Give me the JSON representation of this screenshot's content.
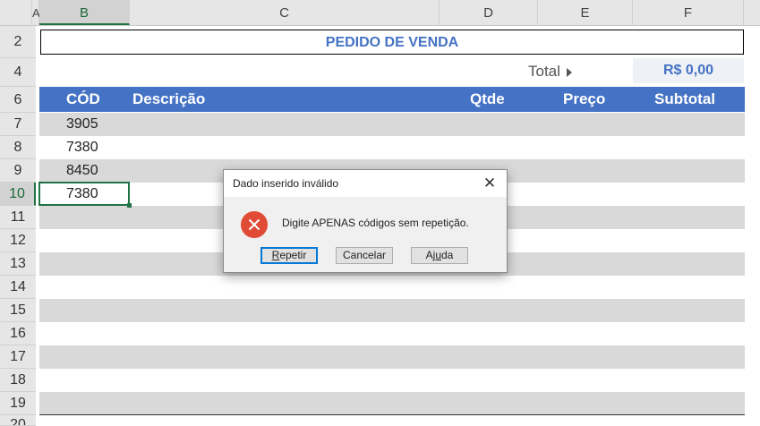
{
  "columns": [
    {
      "label": "A",
      "selected": false
    },
    {
      "label": "B",
      "selected": true
    },
    {
      "label": "C",
      "selected": false
    },
    {
      "label": "D",
      "selected": false
    },
    {
      "label": "E",
      "selected": false
    },
    {
      "label": "F",
      "selected": false
    }
  ],
  "row_numbers": [
    "2",
    "4",
    "6",
    "7",
    "8",
    "9",
    "10",
    "11",
    "12",
    "13",
    "14",
    "15",
    "16",
    "17",
    "18",
    "19",
    "20"
  ],
  "sheet": {
    "title": "PEDIDO DE VENDA",
    "total_label": "Total",
    "total_value": "R$ 0,00",
    "headers": {
      "cod": "CÓD",
      "descricao": "Descrição",
      "qtde": "Qtde",
      "preco": "Preço",
      "subtotal": "Subtotal"
    },
    "rows": [
      {
        "cod": "3905"
      },
      {
        "cod": "7380"
      },
      {
        "cod": "8450"
      },
      {
        "cod": "7380"
      },
      {
        "cod": ""
      },
      {
        "cod": ""
      },
      {
        "cod": ""
      },
      {
        "cod": ""
      },
      {
        "cod": ""
      },
      {
        "cod": ""
      },
      {
        "cod": ""
      },
      {
        "cod": ""
      },
      {
        "cod": ""
      }
    ]
  },
  "dialog": {
    "title": "Dado inserido inválido",
    "close": "✕",
    "message": "Digite APENAS códigos sem repetição.",
    "buttons": {
      "repetir_pre": "",
      "repetir_key": "R",
      "repetir_post": "epetir",
      "cancelar": "Cancelar",
      "ajuda_pre": "Aj",
      "ajuda_key": "u",
      "ajuda_post": "da"
    }
  },
  "colors": {
    "accent": "#4472c4",
    "selection": "#217346",
    "error": "#e04b36"
  },
  "icons": [
    "error-icon",
    "close-icon",
    "arrow-right-icon"
  ]
}
